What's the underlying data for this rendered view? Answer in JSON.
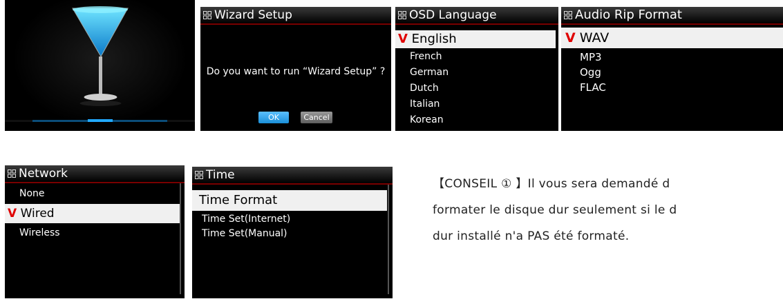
{
  "wizard": {
    "title": "Wizard Setup",
    "question": "Do you want to run “Wizard Setup” ?",
    "ok_label": "OK",
    "cancel_label": "Cancel"
  },
  "osd_language": {
    "title": "OSD Language",
    "items": [
      "English",
      "French",
      "German",
      "Dutch",
      "Italian",
      "Korean"
    ],
    "selected_check": "V"
  },
  "audio_rip": {
    "title": "Audio Rip Format",
    "items": [
      "WAV",
      "MP3",
      "Ogg",
      "FLAC"
    ],
    "selected_check": "V"
  },
  "network": {
    "title": "Network",
    "items": [
      "None",
      "Wired",
      "Wireless"
    ],
    "selected_check": "V"
  },
  "time": {
    "title": "Time",
    "items": [
      "Time Format",
      "Time Set(Internet)",
      "Time Set(Manual)"
    ]
  },
  "tip": {
    "line1": "【CONSEIL ① 】Il vous sera demandé d",
    "line2": "formater le disque dur seulement si le d",
    "line3": "dur installé n'a PAS été formaté."
  },
  "colors": {
    "check": "#e00000",
    "selection_bg": "#f0f0f0",
    "title_underline": "#7a0000",
    "glass_blue": "#22c8ff",
    "ok_button": "#1a8fd8"
  },
  "icons": {
    "title": "menu-grid-icon",
    "splash": "cocktail-glass-icon",
    "selected": "checkmark-icon"
  }
}
